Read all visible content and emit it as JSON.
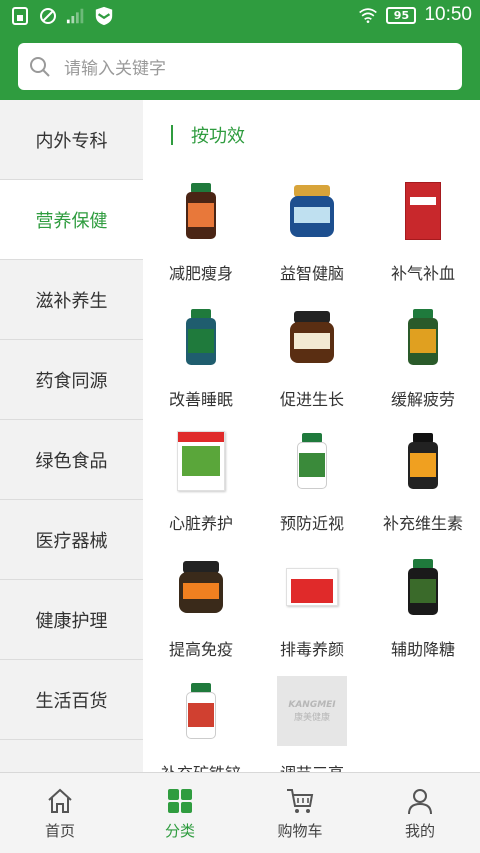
{
  "status_bar": {
    "time": "10:50",
    "battery": "95",
    "icons": [
      "sim-icon",
      "no-signal-icon",
      "signal-bars-icon",
      "shield-app-icon",
      "wifi-icon",
      "battery-icon"
    ]
  },
  "search": {
    "placeholder": "请输入关键字",
    "icon": "search-icon"
  },
  "sidebar": {
    "items": [
      {
        "label": "内外专科",
        "active": false
      },
      {
        "label": "营养保健",
        "active": true
      },
      {
        "label": "滋补养生",
        "active": false
      },
      {
        "label": "药食同源",
        "active": false
      },
      {
        "label": "绿色食品",
        "active": false
      },
      {
        "label": "医疗器械",
        "active": false
      },
      {
        "label": "健康护理",
        "active": false
      },
      {
        "label": "生活百货",
        "active": false
      }
    ]
  },
  "content": {
    "section_title": "按功效",
    "products": [
      {
        "label": "减肥瘦身"
      },
      {
        "label": "益智健脑"
      },
      {
        "label": "补气补血"
      },
      {
        "label": "改善睡眠"
      },
      {
        "label": "促进生长"
      },
      {
        "label": "缓解疲劳"
      },
      {
        "label": "心脏养护"
      },
      {
        "label": "预防近视"
      },
      {
        "label": "补充维生素"
      },
      {
        "label": "提高免疫"
      },
      {
        "label": "排毒养颜"
      },
      {
        "label": "辅助降糖"
      },
      {
        "label": "补充矿铁锌"
      },
      {
        "label": "调节三高",
        "placeholder_logo": {
          "line1": "KANGMEI",
          "line2": "康美健康"
        }
      }
    ]
  },
  "bottom_nav": {
    "items": [
      {
        "label": "首页",
        "icon": "home-icon",
        "active": false
      },
      {
        "label": "分类",
        "icon": "category-icon",
        "active": true
      },
      {
        "label": "购物车",
        "icon": "cart-icon",
        "active": false
      },
      {
        "label": "我的",
        "icon": "profile-icon",
        "active": false
      }
    ]
  },
  "colors": {
    "brand_green": "#2f9c3f",
    "text": "#333333",
    "placeholder": "#9a9a9a"
  }
}
